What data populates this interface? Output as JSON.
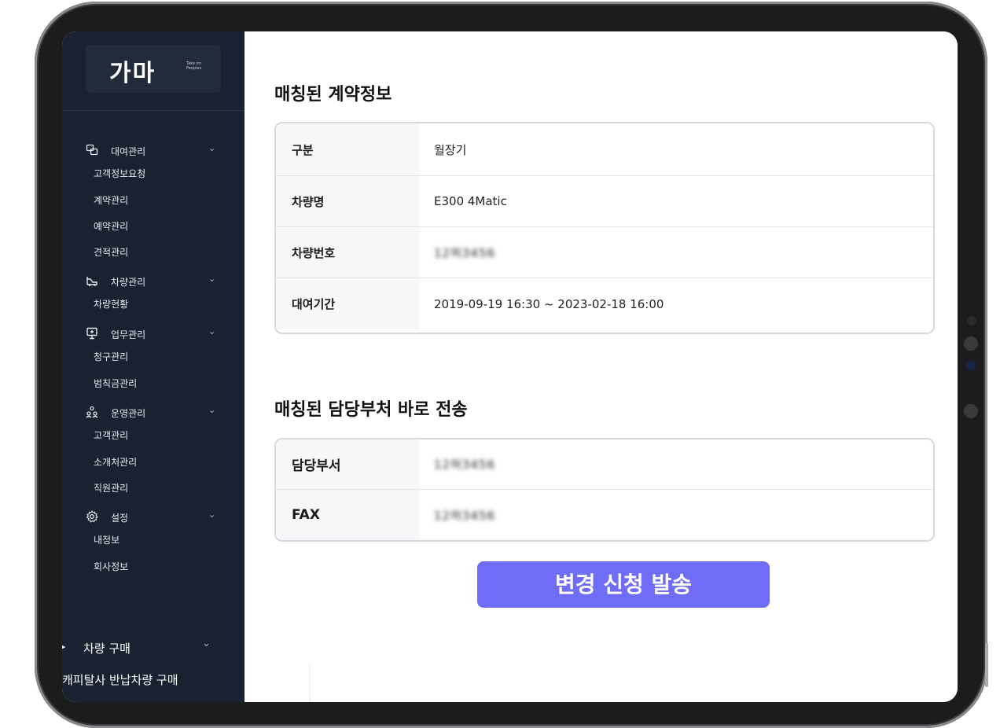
{
  "logo": {
    "text": "가마",
    "sub": "Take on\nPeoples"
  },
  "sidebar": {
    "groups": [
      {
        "icon": "car-rental-icon",
        "label": "대여관리",
        "items": [
          "고객정보요청",
          "계약관리",
          "예약관리",
          "견적관리"
        ]
      },
      {
        "icon": "car-icon",
        "label": "차량관리",
        "items": [
          "차량현황"
        ]
      },
      {
        "icon": "presentation-icon",
        "label": "업무관리",
        "items": [
          "청구관리",
          "범칙금관리"
        ]
      },
      {
        "icon": "people-icon",
        "label": "운영관리",
        "items": [
          "고객관리",
          "소개처관리",
          "직원관리"
        ]
      },
      {
        "icon": "gear-icon",
        "label": "설정",
        "items": [
          "내정보",
          "회사정보"
        ]
      }
    ],
    "purchase": {
      "label": "차량 구매",
      "sub_label": "캐피탈사 반납차량 구매"
    }
  },
  "contract": {
    "title": "매칭된 계약정보",
    "rows": [
      {
        "label": "구분",
        "value": "월장기"
      },
      {
        "label": "차량명",
        "value": "E300 4Matic"
      },
      {
        "label": "차량번호",
        "value": "12허3456"
      },
      {
        "label": "대여기간",
        "value": "2019-09-19 16:30 ~ 2023-02-18 16:00"
      }
    ]
  },
  "dept": {
    "title": "매칭된 담당부처 바로 전송",
    "rows": [
      {
        "label": "담당부서",
        "value": "12허3456"
      },
      {
        "label": "FAX",
        "value": "12허3456"
      }
    ]
  },
  "actions": {
    "send_label": "변경 신청 발송"
  },
  "colors": {
    "sidebar_bg": "#1a2232",
    "accent": "#6f6cf6"
  }
}
